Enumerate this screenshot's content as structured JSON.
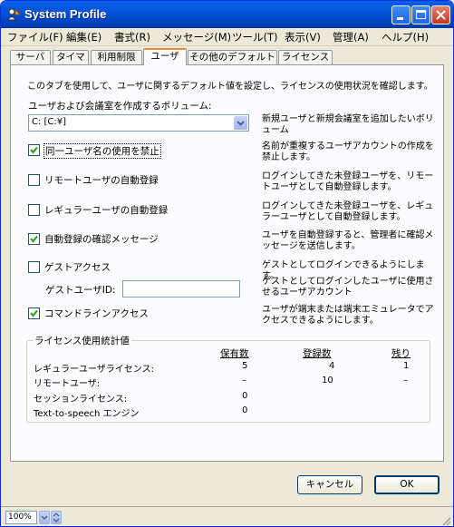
{
  "window": {
    "title": "System Profile"
  },
  "menu": [
    "ファイル(F)",
    "編集(E)",
    "書式(R)",
    "メッセージ(M)",
    "ツール(T)",
    "表示(V)",
    "管理(A)",
    "ヘルプ(H)"
  ],
  "tabs": [
    "サーバ",
    "タイマ",
    "利用制限",
    "ユーザ",
    "その他のデフォルト",
    "ライセンス"
  ],
  "active_tab": "ユーザ",
  "intro": "このタブを使用して、ユーザに関するデフォルト値を設定し、ライセンスの使用状況を確認します。",
  "volume": {
    "label": "ユーザおよび会議室を作成するボリューム:",
    "value": "C: [C:¥]",
    "desc": "新規ユーザと新規会議室を追加したいボリューム"
  },
  "options": [
    {
      "label": "同一ユーザ名の使用を禁止",
      "checked": true,
      "desc": "名前が重複するユーザアカウントの作成を禁止します。"
    },
    {
      "label": "リモートユーザの自動登録",
      "checked": false,
      "desc": "ログインしてきた未登録ユーザを、リモートユーザとして自動登録します。"
    },
    {
      "label": "レギュラーユーザの自動登録",
      "checked": false,
      "desc": "ログインしてきた未登録ユーザを、レギュラーユーザとして自動登録します。"
    },
    {
      "label": "自動登録の確認メッセージ",
      "checked": true,
      "desc": "ユーザを自動登録すると、管理者に確認メッセージを送信します。"
    },
    {
      "label": "ゲストアクセス",
      "checked": false,
      "desc": "ゲストとしてログインできるようにします。"
    },
    {
      "label": "コマンドラインアクセス",
      "checked": true,
      "desc": "ユーザが端末または端末エミュレータでアクセスできるようにします。"
    }
  ],
  "guest_user": {
    "label": "ゲストユーザID:",
    "value": "",
    "desc": "ゲストとしてログインしたユーザに使用させるユーザアカウント"
  },
  "license": {
    "title": "ライセンス使用統計値",
    "columns": [
      "保有数",
      "登録数",
      "残り"
    ],
    "rows": [
      {
        "name": "レギュラーユーザライセンス:",
        "held": "5",
        "registered": "4",
        "remaining": "1"
      },
      {
        "name": "リモートユーザ:",
        "held": "–",
        "registered": "10",
        "remaining": "–"
      },
      {
        "name": "セッションライセンス:",
        "held": "0",
        "registered": "",
        "remaining": ""
      },
      {
        "name": "Text-to-speech エンジン",
        "held": "0",
        "registered": "",
        "remaining": ""
      }
    ]
  },
  "buttons": {
    "cancel": "キャンセル",
    "ok": "OK"
  },
  "status": {
    "zoom": "100%"
  },
  "colors": {
    "title_blue": "#0553d8",
    "tab_accent": "#e68b2c",
    "check_green": "#21a121"
  }
}
